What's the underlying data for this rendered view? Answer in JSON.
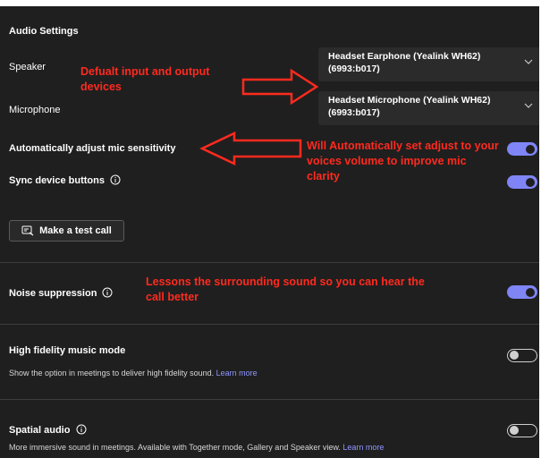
{
  "section_title": "Audio Settings",
  "speaker": {
    "label": "Speaker",
    "device": "Headset Earphone (Yealink WH62) (6993:b017)"
  },
  "microphone": {
    "label": "Microphone",
    "device": "Headset Microphone (Yealink WH62) (6993:b017)"
  },
  "auto_adjust": {
    "label": "Automatically adjust mic sensitivity",
    "enabled": true
  },
  "sync_buttons": {
    "label": "Sync device buttons",
    "enabled": true
  },
  "test_call": {
    "label": "Make a test call"
  },
  "noise_suppression": {
    "label": "Noise suppression",
    "enabled": true
  },
  "high_fidelity": {
    "label": "High fidelity music mode",
    "description": "Show the option in meetings to deliver high fidelity sound.",
    "link": "Learn more",
    "enabled": false
  },
  "spatial_audio": {
    "label": "Spatial audio",
    "description": "More immersive sound in meetings. Available with Together mode, Gallery and Speaker view.",
    "link": "Learn more",
    "enabled": false
  },
  "annotations": {
    "devices": "Defualt input and output devices",
    "auto_adjust": "Will Automatically set adjust to your voices volume to improve mic clarity",
    "noise": "Lessons the surrounding sound so you can hear the call better"
  },
  "colors": {
    "background": "#1f1f1f",
    "toggle_on": "#7f85f5",
    "link": "#8f96ff",
    "annotation": "#ff2a1f"
  },
  "icons": {
    "dropdown": "chevron-down-icon",
    "info": "info-icon",
    "test_call": "test-call-icon",
    "annotation_arrow": "arrow-icon"
  }
}
